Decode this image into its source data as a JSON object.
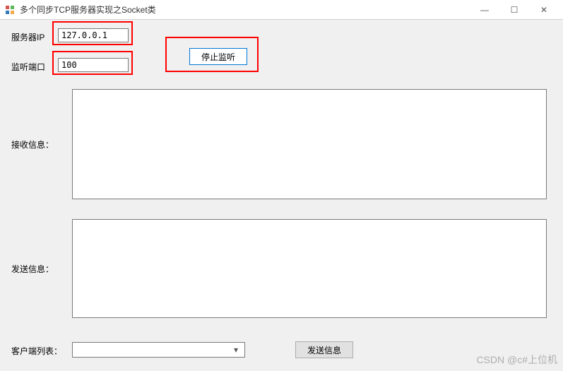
{
  "window": {
    "title": "多个同步TCP服务器实现之Socket类",
    "minimize_label": "—",
    "maximize_label": "☐",
    "close_label": "✕"
  },
  "labels": {
    "server_ip": "服务器IP",
    "listen_port": "监听端口",
    "receive_info": "接收信息：",
    "send_info": "发送信息：",
    "client_list": "客户端列表："
  },
  "fields": {
    "server_ip_value": "127.0.0.1",
    "listen_port_value": "100",
    "receive_text": "",
    "send_text": "",
    "client_selected": ""
  },
  "buttons": {
    "stop_listen": "停止监听",
    "send_info": "发送信息"
  },
  "annotations": {
    "boxes": [
      "server-ip-box",
      "listen-port-box",
      "listen-button-box"
    ]
  },
  "watermark": "CSDN @c#上位机"
}
